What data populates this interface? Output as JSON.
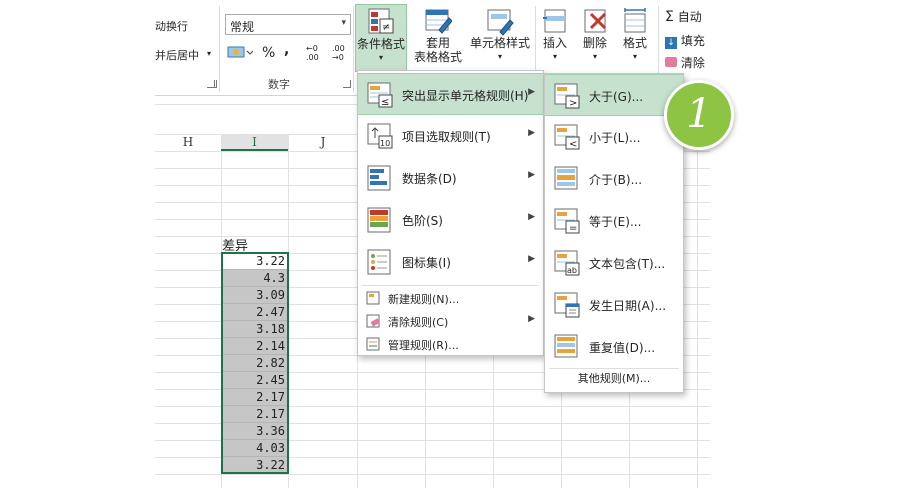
{
  "ribbon": {
    "alignment": {
      "wrap_text": "动换行",
      "merge_center": "并后居中"
    },
    "number": {
      "format_value": "常规",
      "percent": "%",
      "comma": ",",
      "increase_decimal": "←0 .00",
      "decrease_decimal": ".00 →0",
      "group_label": "数字"
    },
    "styles": {
      "conditional_formatting": "条件格式",
      "format_as_table_line1": "套用",
      "format_as_table_line2": "表格格式",
      "cell_styles": "单元格样式"
    },
    "cells": {
      "insert": "插入",
      "delete": "删除",
      "format": "格式"
    },
    "editing": {
      "autosum": "自动",
      "fill": "填充",
      "clear": "清除"
    }
  },
  "sheet": {
    "columns": [
      "H",
      "I",
      "J"
    ],
    "selected_column": "I",
    "header_label": "差异",
    "values": [
      "3.22",
      "4.3",
      "3.09",
      "2.47",
      "3.18",
      "2.14",
      "2.82",
      "2.45",
      "2.17",
      "2.17",
      "3.36",
      "4.03",
      "3.22"
    ]
  },
  "menu": {
    "items": [
      {
        "label": "突出显示单元格规则(H)",
        "icon": "highlight-rules-icon"
      },
      {
        "label": "项目选取规则(T)",
        "icon": "top-bottom-rules-icon"
      },
      {
        "label": "数据条(D)",
        "icon": "data-bars-icon"
      },
      {
        "label": "色阶(S)",
        "icon": "color-scales-icon"
      },
      {
        "label": "图标集(I)",
        "icon": "icon-sets-icon"
      }
    ],
    "small_items": [
      {
        "label": "新建规则(N)...",
        "icon": "new-rule-icon"
      },
      {
        "label": "清除规则(C)",
        "icon": "clear-rules-icon"
      },
      {
        "label": "管理规则(R)...",
        "icon": "manage-rules-icon"
      }
    ]
  },
  "submenu": {
    "items": [
      {
        "label": "大于(G)...",
        "icon": "greater-than-icon"
      },
      {
        "label": "小于(L)...",
        "icon": "less-than-icon"
      },
      {
        "label": "介于(B)...",
        "icon": "between-icon"
      },
      {
        "label": "等于(E)...",
        "icon": "equal-to-icon"
      },
      {
        "label": "文本包含(T)...",
        "icon": "text-contains-icon"
      },
      {
        "label": "发生日期(A)...",
        "icon": "date-occurring-icon"
      },
      {
        "label": "重复值(D)...",
        "icon": "duplicate-values-icon"
      }
    ],
    "more_rules": "其他规则(M)..."
  },
  "step": {
    "number": "1"
  },
  "colors": {
    "accent": "#217346",
    "highlight": "#c6e2cf",
    "badge": "#8dc443"
  }
}
